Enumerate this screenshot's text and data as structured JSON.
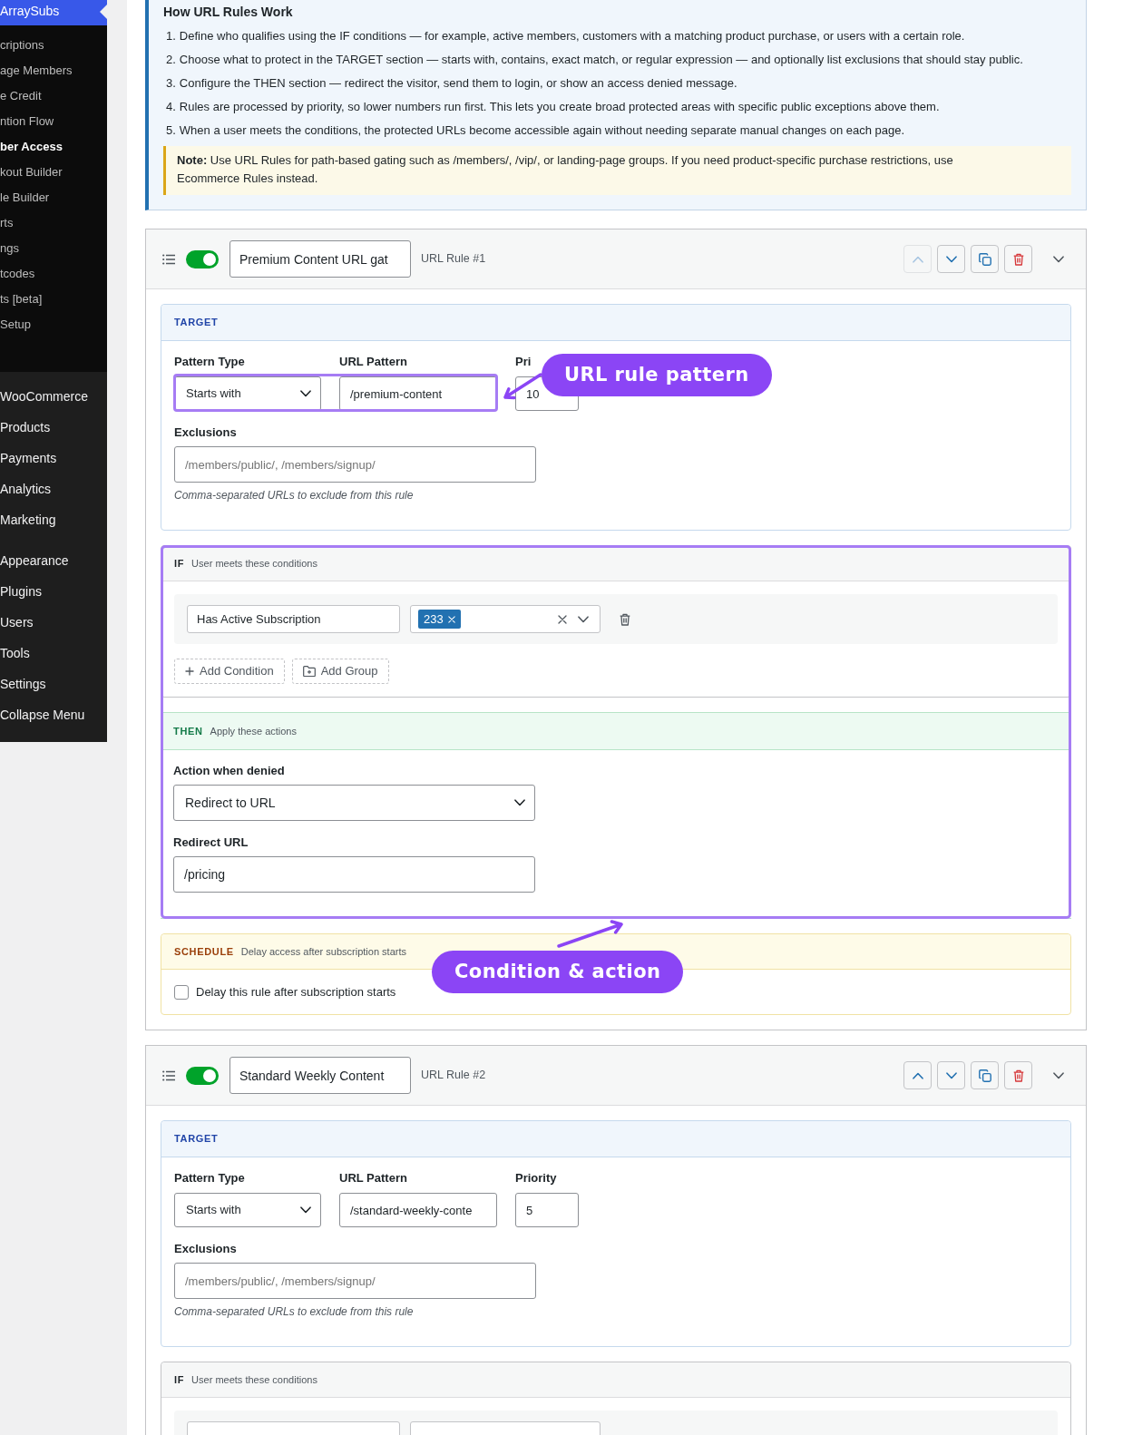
{
  "sidebar": {
    "parent": {
      "label": "ArraySubs",
      "selected": true
    },
    "submenu": [
      {
        "label": "criptions",
        "selected": false
      },
      {
        "label": "age Members",
        "selected": false
      },
      {
        "label": "e Credit",
        "selected": false
      },
      {
        "label": "ntion Flow",
        "selected": false
      },
      {
        "label": "ber Access",
        "selected": true
      },
      {
        "label": "kout Builder",
        "selected": false
      },
      {
        "label": "le Builder",
        "selected": false
      },
      {
        "label": "rts",
        "selected": false
      },
      {
        "label": "ngs",
        "selected": false
      },
      {
        "label": "tcodes",
        "selected": false
      },
      {
        "label": "ts [beta]",
        "selected": false
      },
      {
        "label": "Setup",
        "selected": false
      }
    ],
    "menu": [
      {
        "items": [
          {
            "label": "WooCommerce",
            "selected": false
          },
          {
            "label": "Products",
            "selected": false
          },
          {
            "label": "Payments",
            "selected": false
          },
          {
            "label": "Analytics",
            "selected": false
          },
          {
            "label": "Marketing",
            "selected": false
          }
        ]
      },
      {
        "items": [
          {
            "label": "Appearance",
            "selected": false
          },
          {
            "label": "Plugins",
            "selected": false
          },
          {
            "label": "Users",
            "selected": false
          },
          {
            "label": "Tools",
            "selected": false
          },
          {
            "label": "Settings",
            "selected": false
          },
          {
            "label": "Collapse Menu",
            "selected": false
          }
        ]
      }
    ]
  },
  "info": {
    "title": "How URL Rules Work",
    "steps": [
      {
        "number": "1.",
        "text": "Define who qualifies using the IF conditions — for example, active members, customers with a matching product purchase, or users with a certain role."
      },
      {
        "number": "2.",
        "text": "Choose what to protect in the TARGET section — starts with, contains, exact match, or regular expression — and optionally list exclusions that should stay public."
      },
      {
        "number": "3.",
        "text": "Configure the THEN section — redirect the visitor, send them to login, or show an access denied message."
      },
      {
        "number": "4.",
        "text": "Rules are processed by priority, so lower numbers run first. This lets you create broad protected areas with specific public exceptions above them."
      },
      {
        "number": "5.",
        "text": "When a user meets the conditions, the protected URLs become accessible again without needing separate manual changes on each page."
      }
    ],
    "note": "**Note:** Use URL Rules for path-based gating such as /members/, /vip/, or landing-page groups. If you need product-specific purchase restrictions, use Ecommerce Rules instead."
  },
  "rules": [
    {
      "title": "Premium Content URL gat",
      "label": "URL Rule #1",
      "enabled": true,
      "expanded": true,
      "actions": [
        {
          "kind": "move_up",
          "disabled": true
        },
        {
          "kind": "move_down",
          "disabled": false
        },
        {
          "kind": "duplicate",
          "disabled": false
        },
        {
          "kind": "delete",
          "disabled": false
        }
      ],
      "target": {
        "heading": "TARGET",
        "highlighted": true,
        "callout": "URL rule pattern",
        "fields": [
          {
            "kind": "select",
            "label": "Pattern Type",
            "value": "Starts with"
          },
          {
            "kind": "input",
            "label": "URL Pattern",
            "value": "/premium-content"
          },
          {
            "kind": "input",
            "label": "Pri",
            "value": "10"
          }
        ],
        "exclusions": {
          "label": "Exclusions",
          "placeholder": "/members/public/, /members/signup/",
          "hint": "Comma-separated URLs to exclude from this rule"
        }
      },
      "logic": {
        "highlighted": true,
        "callout": "Condition & action",
        "if": {
          "heading": "IF",
          "subheading": "User meets these conditions",
          "rows": [
            {
              "kind": "condition",
              "field": "Has Active Subscription",
              "tags": [
                "233"
              ]
            }
          ],
          "buttons": [
            {
              "kind": "add_condition",
              "label": "Add Condition"
            },
            {
              "kind": "add_group",
              "label": "Add Group"
            }
          ]
        },
        "then": {
          "heading": "THEN",
          "subheading": "Apply these actions",
          "fields": [
            {
              "kind": "select",
              "label": "Action when denied",
              "value": "Redirect to URL"
            },
            {
              "kind": "input",
              "label": "Redirect URL",
              "value": "/pricing"
            }
          ]
        }
      },
      "schedule": {
        "heading": "SCHEDULE",
        "subheading": "Delay access after subscription starts",
        "checkbox": {
          "label": "Delay this rule after subscription starts",
          "checked": false
        }
      }
    },
    {
      "title": "Standard Weekly Content",
      "label": "URL Rule #2",
      "enabled": true,
      "expanded": true,
      "actions": [
        {
          "kind": "move_up",
          "disabled": false
        },
        {
          "kind": "move_down",
          "disabled": false
        },
        {
          "kind": "duplicate",
          "disabled": false
        },
        {
          "kind": "delete",
          "disabled": false
        }
      ],
      "target": {
        "heading": "TARGET",
        "highlighted": false,
        "fields": [
          {
            "kind": "select",
            "label": "Pattern Type",
            "value": "Starts with"
          },
          {
            "kind": "input",
            "label": "URL Pattern",
            "value": "/standard-weekly-conte"
          },
          {
            "kind": "input",
            "label": "Priority",
            "value": "5"
          }
        ],
        "exclusions": {
          "label": "Exclusions",
          "placeholder": "/members/public/, /members/signup/",
          "hint": "Comma-separated URLs to exclude from this rule"
        }
      },
      "logic": {
        "highlighted": false,
        "if": {
          "heading": "IF",
          "subheading": "User meets these conditions",
          "rows": [
            {
              "kind": "condition"
            }
          ]
        }
      }
    }
  ]
}
